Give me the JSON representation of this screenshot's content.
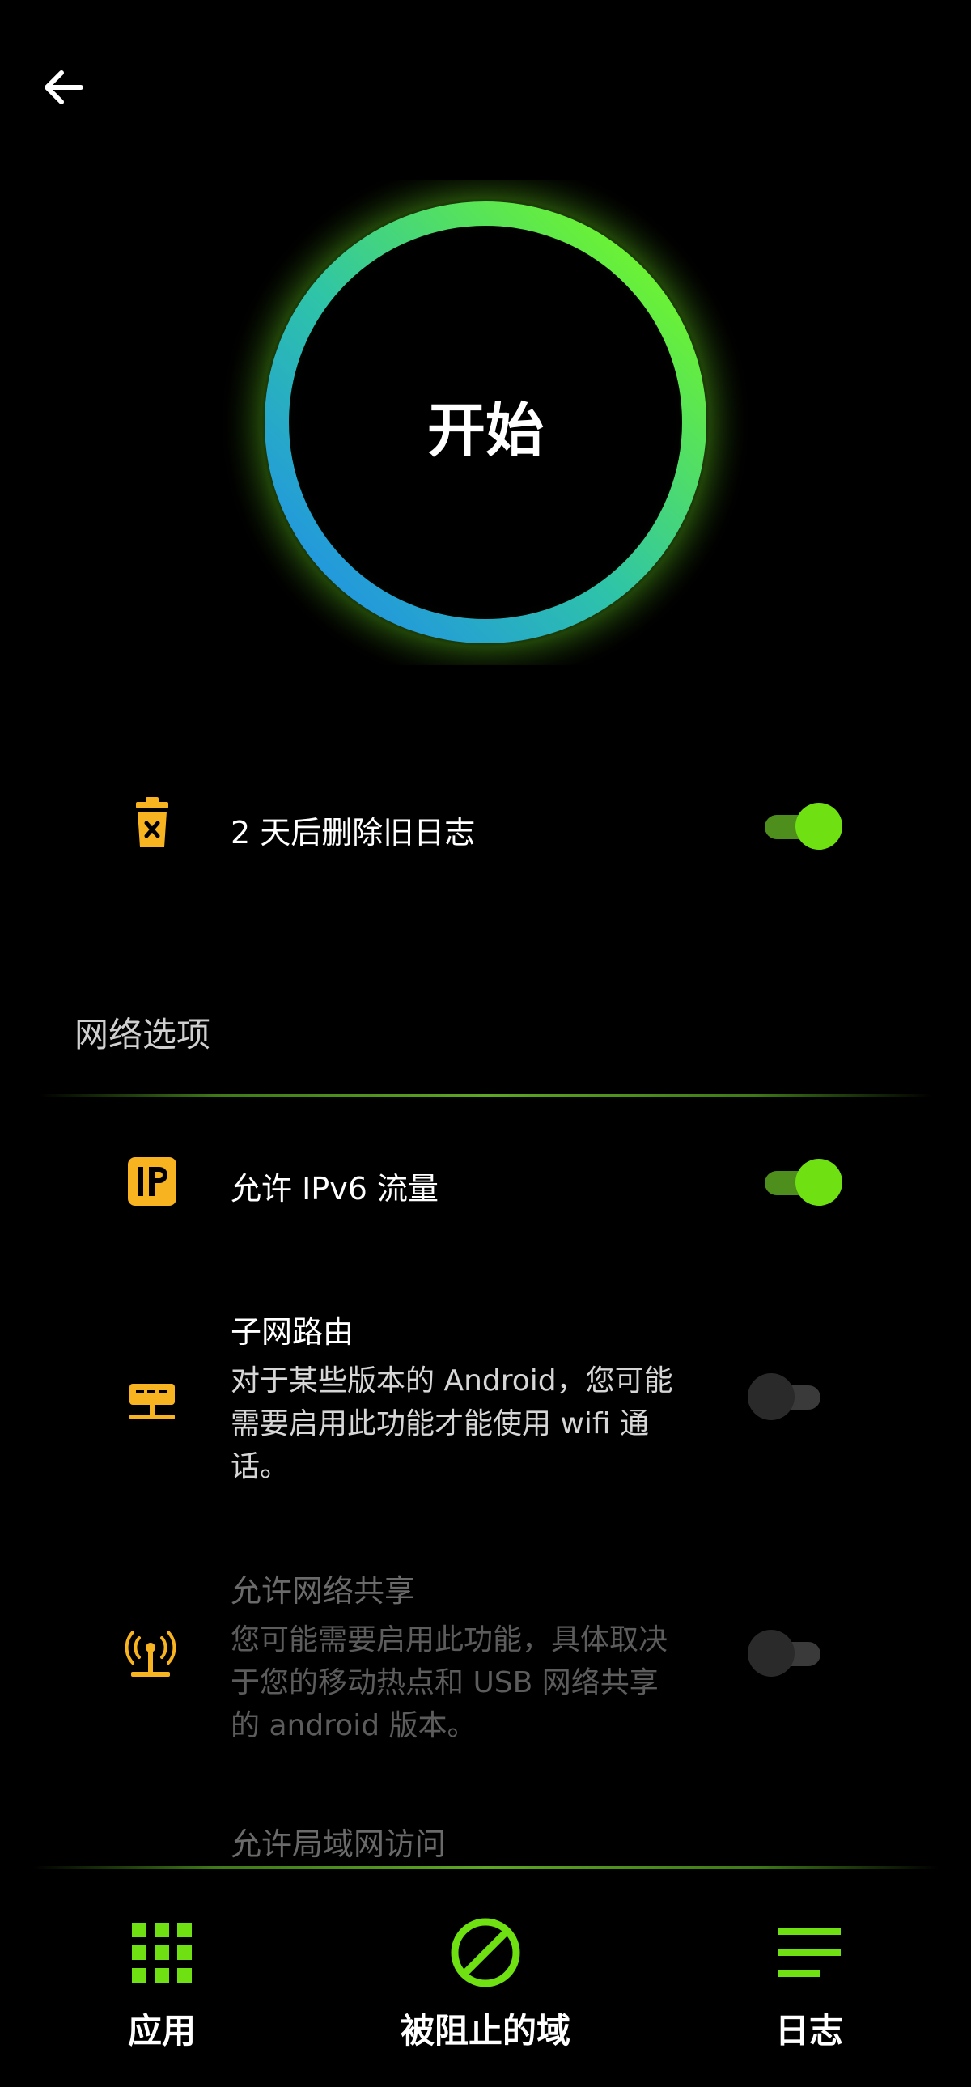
{
  "start_button": {
    "label": "开始"
  },
  "settings": {
    "log_row": {
      "title": "2 天后删除旧日志",
      "enabled": true
    },
    "network_section": {
      "header": "网络选项",
      "items": [
        {
          "title": "允许 IPv6 流量",
          "enabled": true
        },
        {
          "title": "子网路由",
          "desc_lines": [
            "对于某些版本的 Android，您可能",
            "需要启用此功能才能使用 wifi 通",
            "话。"
          ],
          "enabled": false
        },
        {
          "title": "允许网络共享",
          "desc_lines": [
            "您可能需要启用此功能，具体取决",
            "于您的移动热点和 USB 网络共享",
            "的 android 版本。"
          ],
          "enabled": false
        },
        {
          "title": "允许局域网访问"
        }
      ]
    }
  },
  "bottom_nav": {
    "items": [
      {
        "label": "应用",
        "icon": "apps-grid-icon"
      },
      {
        "label": "被阻止的域",
        "icon": "block-icon"
      },
      {
        "label": "日志",
        "icon": "logs-lines-icon"
      }
    ]
  },
  "colors": {
    "accent_green": "#6fe012",
    "accent_yellow": "#f7b320",
    "ring_blue": "#2196f3",
    "background": "#000000"
  }
}
